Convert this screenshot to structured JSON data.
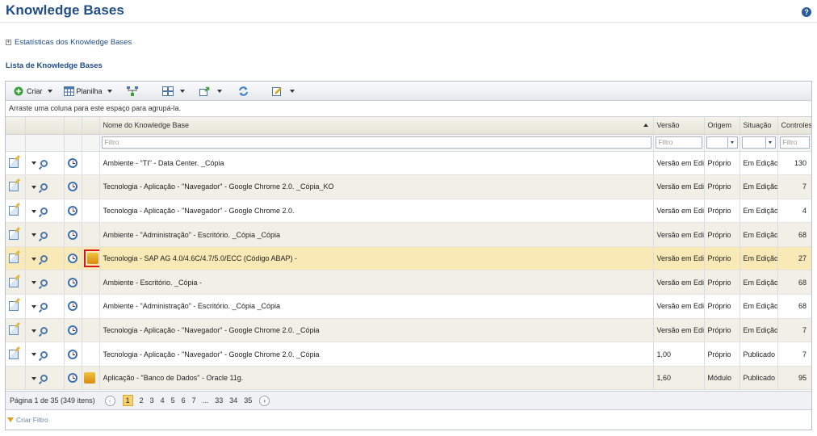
{
  "page": {
    "title": "Knowledge Bases",
    "help_icon": "question-circle-icon"
  },
  "stats_link": {
    "label": "Estatísticas dos Knowledge Bases"
  },
  "section_title": "Lista de Knowledge Bases",
  "toolbar": {
    "create_label": "Criar",
    "sheet_label": "Planilha"
  },
  "group_hint": "Arraste uma coluna para este espaço para agrupá-la.",
  "columns": {
    "name": "Nome do Knowledge Base",
    "version": "Versão",
    "origin": "Origem",
    "status": "Situação",
    "controls": "Controles"
  },
  "filter": {
    "placeholder": "Filtro"
  },
  "rows": [
    {
      "name": "Ambiente - \"TI\" - Data Center. _Cópia",
      "version": "Versão em Edição",
      "origin": "Próprio",
      "status": "Em Edição",
      "controls": "130",
      "has_edit": true,
      "has_sap": false
    },
    {
      "name": "Tecnologia - Aplicação - \"Navegador\" - Google Chrome 2.0. _Cópia_KO",
      "version": "Versão em Edição",
      "origin": "Próprio",
      "status": "Em Edição",
      "controls": "7",
      "has_edit": true,
      "has_sap": false
    },
    {
      "name": "Tecnologia - Aplicação - \"Navegador\" - Google Chrome 2.0.",
      "version": "Versão em Edição",
      "origin": "Próprio",
      "status": "Em Edição",
      "controls": "4",
      "has_edit": true,
      "has_sap": false
    },
    {
      "name": "Ambiente - \"Administração\" - Escritório. _Cópia _Cópia",
      "version": "Versão em Edição",
      "origin": "Próprio",
      "status": "Em Edição",
      "controls": "68",
      "has_edit": true,
      "has_sap": false
    },
    {
      "name": "Tecnologia - SAP AG 4.0/4.6C/4.7/5.0/ECC (Código ABAP) -",
      "version": "Versão em Edição",
      "origin": "Próprio",
      "status": "Em Edição",
      "controls": "27",
      "has_edit": true,
      "has_sap": true,
      "selected": true
    },
    {
      "name": "Ambiente - Escritório. _Cópia -",
      "version": "Versão em Edição",
      "origin": "Próprio",
      "status": "Em Edição",
      "controls": "68",
      "has_edit": true,
      "has_sap": false
    },
    {
      "name": "Ambiente - \"Administração\" - Escritório. _Cópia _Cópia",
      "version": "Versão em Edição",
      "origin": "Próprio",
      "status": "Em Edição",
      "controls": "68",
      "has_edit": true,
      "has_sap": false
    },
    {
      "name": "Tecnologia - Aplicação - \"Navegador\" - Google Chrome 2.0. _Cópia",
      "version": "Versão em Edição",
      "origin": "Próprio",
      "status": "Em Edição",
      "controls": "7",
      "has_edit": true,
      "has_sap": false
    },
    {
      "name": "Tecnologia - Aplicação - \"Navegador\" - Google Chrome 2.0. _Cópia",
      "version": "1,00",
      "origin": "Próprio",
      "status": "Publicado",
      "controls": "7",
      "has_edit": true,
      "has_sap": false
    },
    {
      "name": "Aplicação - \"Banco de Dados\" - Oracle 11g.",
      "version": "1,60",
      "origin": "Módulo",
      "status": "Publicado",
      "controls": "95",
      "has_edit": false,
      "has_sap": true
    }
  ],
  "pager": {
    "info": "Página 1 de 35 (349 itens)",
    "prev": "‹",
    "next": "›",
    "pages": [
      "1",
      "2",
      "3",
      "4",
      "5",
      "6",
      "7",
      "...",
      "33",
      "34",
      "35"
    ],
    "current": "1"
  },
  "create_filter": "Criar Filtro",
  "colors": {
    "title_blue": "#1e4c87",
    "row_alt": "#f2f0e6",
    "row_selected": "#f9e9b6",
    "published": "#a07c1a",
    "highlight_red": "#d8161b"
  }
}
